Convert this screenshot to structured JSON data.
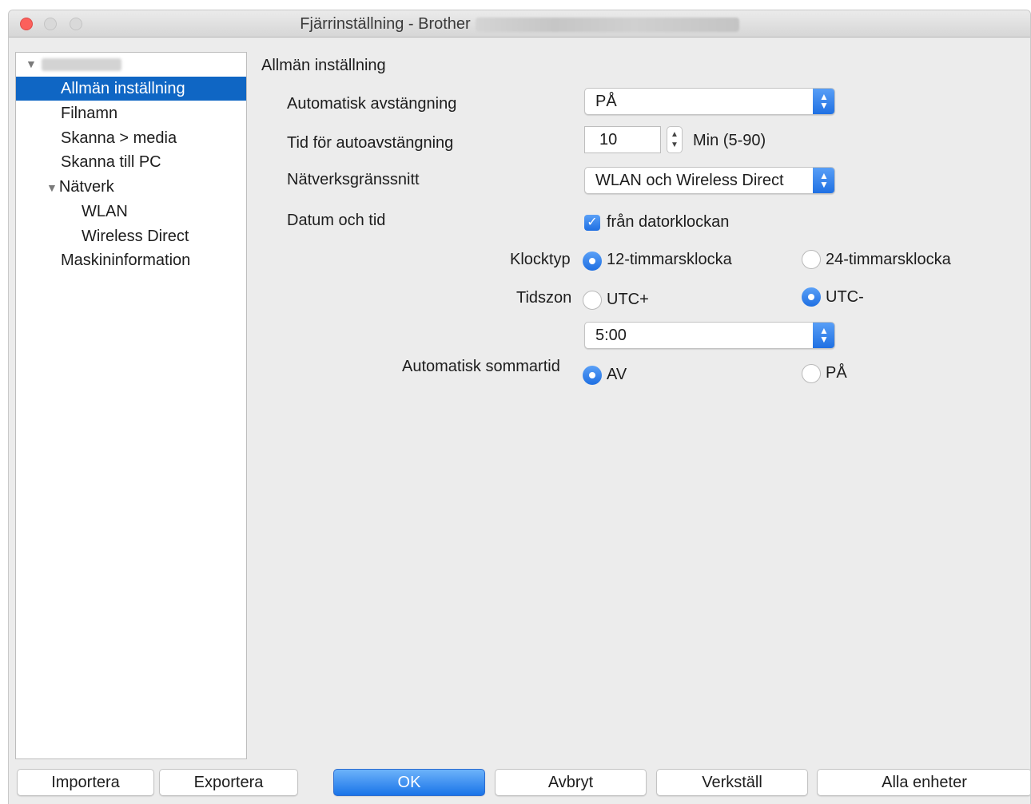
{
  "window": {
    "title": "Fjärrinställning - Brother"
  },
  "sidebar": {
    "items": [
      {
        "label": "Allmän inställning",
        "selected": true
      },
      {
        "label": "Filnamn"
      },
      {
        "label": "Skanna > media"
      },
      {
        "label": "Skanna till PC"
      },
      {
        "label": "Nätverk",
        "expanded": true
      },
      {
        "label": "WLAN"
      },
      {
        "label": "Wireless Direct"
      },
      {
        "label": "Maskininformation"
      }
    ]
  },
  "main": {
    "title": "Allmän inställning",
    "auto_off": {
      "label": "Automatisk avstängning",
      "value": "PÅ"
    },
    "auto_off_time": {
      "label": "Tid för autoavstängning",
      "value": "10",
      "unit": "Min (5-90)"
    },
    "network_interface": {
      "label": "Nätverksgränssnitt",
      "value": "WLAN och Wireless Direct"
    },
    "date_time": {
      "label": "Datum och tid",
      "checkbox_label": "från datorklockan",
      "checked": true
    },
    "clock_type": {
      "label": "Klocktyp",
      "option_12": "12-timmarsklocka",
      "option_24": "24-timmarsklocka",
      "selected": "12-timmarsklocka"
    },
    "timezone": {
      "label": "Tidszon",
      "option_plus": "UTC+",
      "option_minus": "UTC-",
      "selected": "UTC-",
      "value": "5:00"
    },
    "dst": {
      "label": "Automatisk sommartid",
      "option_off": "AV",
      "option_on": "PÅ",
      "selected": "AV"
    }
  },
  "footer": {
    "import": "Importera",
    "export": "Exportera",
    "ok": "OK",
    "cancel": "Avbryt",
    "apply": "Verkställ",
    "all_devices": "Alla enheter"
  },
  "colors": {
    "accent": "#1e6fe2",
    "selection": "#0f66c4",
    "close": "#fc605c"
  }
}
